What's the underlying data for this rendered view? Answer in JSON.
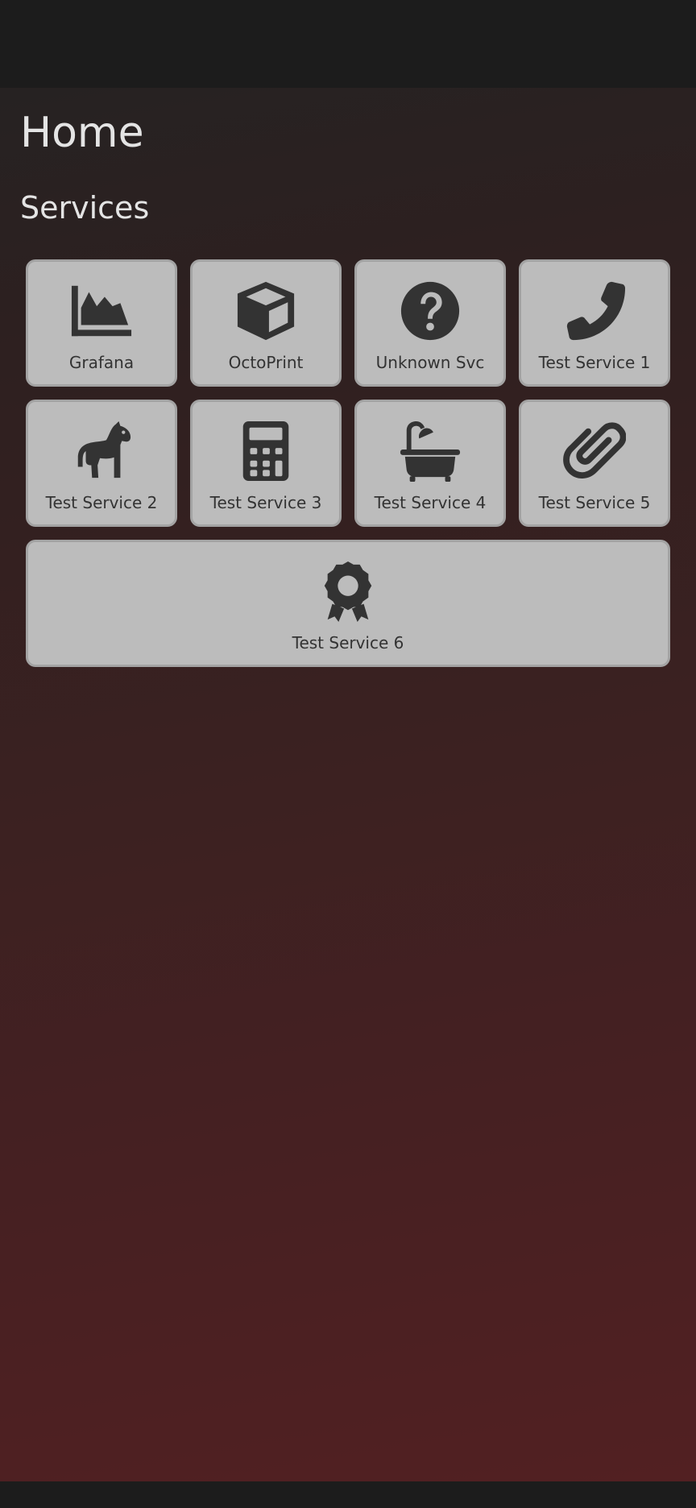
{
  "page": {
    "title": "Home",
    "section_title": "Services"
  },
  "colors": {
    "tile_background": "#bcbcbc",
    "tile_border": "#a3a3a3",
    "icon": "#333333",
    "heading_text": "#e4e4e4"
  },
  "services": [
    {
      "label": "Grafana",
      "icon": "area-chart-icon"
    },
    {
      "label": "OctoPrint",
      "icon": "cube-icon"
    },
    {
      "label": "Unknown Svc",
      "icon": "question-circle-icon"
    },
    {
      "label": "Test Service 1",
      "icon": "phone-icon"
    },
    {
      "label": "Test Service 2",
      "icon": "horse-icon"
    },
    {
      "label": "Test Service 3",
      "icon": "calculator-icon"
    },
    {
      "label": "Test Service 4",
      "icon": "bath-icon"
    },
    {
      "label": "Test Service 5",
      "icon": "paperclip-icon"
    },
    {
      "label": "Test Service 6",
      "icon": "award-icon"
    }
  ]
}
